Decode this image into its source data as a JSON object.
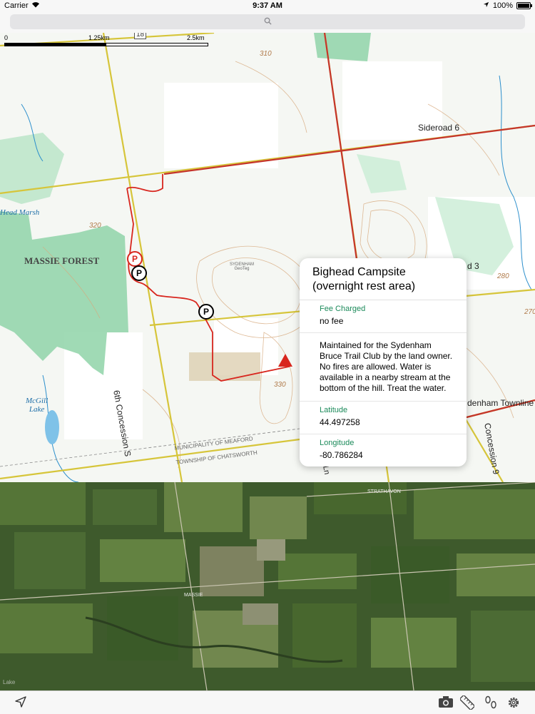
{
  "status": {
    "carrier": "Carrier",
    "time": "9:37 AM",
    "battery": "100%"
  },
  "search": {
    "icon": "search-icon"
  },
  "scale": {
    "zero": "0",
    "mid": "1.25km",
    "end": "2.5km"
  },
  "map_labels": {
    "road18": "18",
    "massie_forest": "MASSIE FOREST",
    "head_marsh": "Head Marsh",
    "mcgill_lake": "McGill\nLake",
    "sideroad6": "Sideroad 6",
    "concession6": "6th Concession S",
    "sydenham": "SYDENHAM\nGeoTeg",
    "road3": "d 3",
    "townline": "denham Townline",
    "concession9": "Concession 9",
    "meaford": "MUNICIPALITY OF MEAFORD",
    "chatsworth": "TOWNSHIP OF CHATSWORTH",
    "elev310": "310",
    "elev320": "320",
    "elev330": "330",
    "elev280": "280",
    "elev270": "270",
    "strathavon": "STRATHAVON",
    "massie": "MASSIE",
    "sat_label": "Lake",
    "ln": "Ln"
  },
  "popup": {
    "title": "Bighead Campsite\n(overnight rest area)",
    "fee_label": "Fee Charged",
    "fee_value": "no fee",
    "description": "Maintained for the Sydenham Bruce Trail Club by the land owner. No fires are allowed. Water is available in a nearby stream at the bottom of the hill. Treat the water.",
    "lat_label": "Latitude",
    "lat_value": "44.497258",
    "lon_label": "Longitude",
    "lon_value": "-80.786284"
  },
  "parking": {
    "p1": "P",
    "p2": "P",
    "p3": "P"
  },
  "toolbar": {
    "locate": "location-arrow-icon",
    "camera": "camera-icon",
    "ruler": "ruler-icon",
    "footprints": "footprints-icon",
    "settings": "gear-icon"
  },
  "colors": {
    "trail": "#d8261e",
    "road": "#d6c53a",
    "forest": "#8fd3a8",
    "water": "#2c8fcc",
    "accent_green": "#1b8a5a"
  }
}
